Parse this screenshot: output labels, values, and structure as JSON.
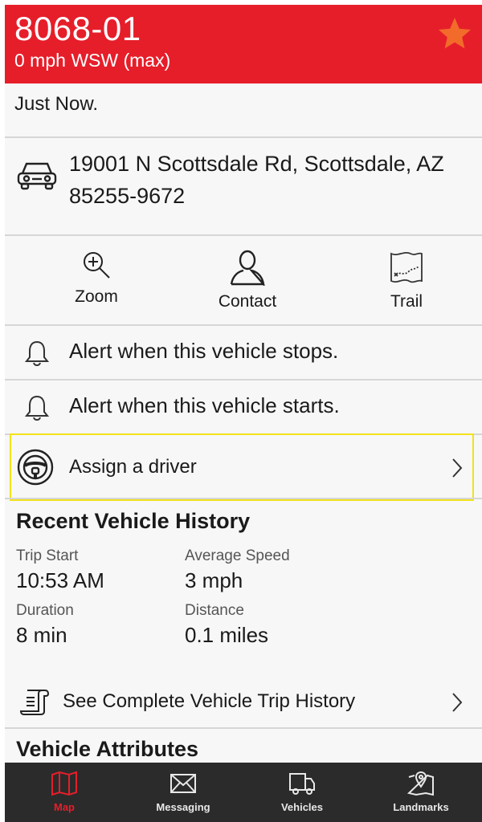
{
  "header": {
    "unit_name": "8068-01",
    "speed_text": "0 mph WSW (max)",
    "favorite": true,
    "accent": "#e61e2a",
    "star_color": "#f26b2a"
  },
  "status": {
    "time": "Just Now."
  },
  "location": {
    "address": "19001 N Scottsdale Rd, Scottsdale, AZ 85255-9672",
    "icon": "car-icon"
  },
  "actions": [
    {
      "label": "Zoom",
      "icon": "zoom-in-icon"
    },
    {
      "label": "Contact",
      "icon": "person-icon"
    },
    {
      "label": "Trail",
      "icon": "map-trail-icon"
    }
  ],
  "alerts": [
    {
      "label": "Alert when this vehicle stops.",
      "icon": "bell-icon"
    },
    {
      "label": "Alert when this vehicle starts.",
      "icon": "bell-icon"
    }
  ],
  "assign_driver": {
    "label": "Assign a driver",
    "icon": "steering-wheel-icon",
    "highlight": "#f2e21a"
  },
  "history": {
    "title": "Recent Vehicle History",
    "stats": [
      {
        "label": "Trip Start",
        "value": "10:53 AM"
      },
      {
        "label": "Average Speed",
        "value": "3 mph"
      },
      {
        "label": "Duration",
        "value": "8 min"
      },
      {
        "label": "Distance",
        "value": "0.1 miles"
      }
    ],
    "link_label": "See Complete Vehicle Trip History"
  },
  "attributes": {
    "title": "Vehicle Attributes"
  },
  "tabs": [
    {
      "label": "Map",
      "icon": "map-icon",
      "active": true
    },
    {
      "label": "Messaging",
      "icon": "envelope-icon",
      "active": false
    },
    {
      "label": "Vehicles",
      "icon": "truck-icon",
      "active": false
    },
    {
      "label": "Landmarks",
      "icon": "landmark-pin-icon",
      "active": false
    }
  ]
}
